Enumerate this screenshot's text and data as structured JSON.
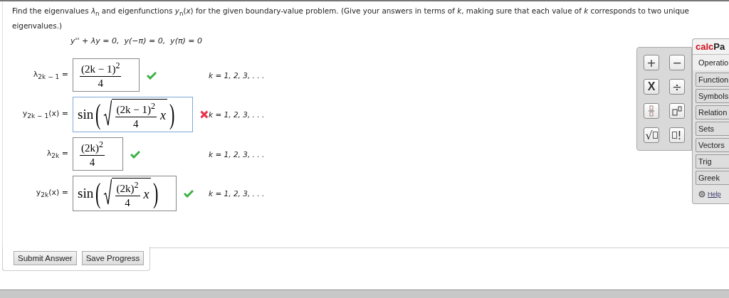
{
  "question": {
    "prompt": "Find the eigenvalues *λ*$_{n}$ and eigenfunctions *y*$_{n}$(*x*) for the given boundary-value problem. (Give your answers in terms of *k*, making sure that each value of *k* corresponds to two unique eigenvalues.)",
    "equation": "y'' + λy = 0,  y(−π) = 0,  y(π) = 0"
  },
  "answers": [
    {
      "label": "λ$_{2k − 1}$ =",
      "kind": "fraction",
      "numerator": "(2k − 1)",
      "exponent": "2",
      "denominator": "4",
      "correct": true,
      "focused": false,
      "range": "k = 1, 2, 3, . . ."
    },
    {
      "label": "y$_{2k − 1}$(x) =",
      "kind": "sine",
      "function": "sin",
      "open": "(",
      "numerator": "(2k − 1)",
      "exponent": "2",
      "denominator": "4",
      "variable": "x",
      "close": ")",
      "correct": false,
      "focused": true,
      "range": "k = 1, 2, 3, . . ."
    },
    {
      "label": "λ$_{2k}$ =",
      "kind": "fraction",
      "numerator": "(2k)",
      "exponent": "2",
      "denominator": "4",
      "correct": true,
      "focused": false,
      "range": "k = 1, 2, 3, . . ."
    },
    {
      "label": "y$_{2k}$(x) =",
      "kind": "sine",
      "function": "sin",
      "open": "(",
      "numerator": "(2k)",
      "exponent": "2",
      "denominator": "4",
      "variable": "x",
      "close": ")",
      "correct": true,
      "focused": false,
      "range": "k = 1, 2, 3, . . ."
    }
  ],
  "buttons": [
    "Submit Answer",
    "Save Progress"
  ],
  "calcpad": {
    "title_accent": "calc",
    "title_rest": "Pa",
    "keys": [
      {
        "kind": "text",
        "text": "+"
      },
      {
        "kind": "text",
        "text": "−"
      },
      {
        "kind": "text",
        "text": "X"
      },
      {
        "kind": "text",
        "text": "÷"
      },
      {
        "kind": "fraction"
      },
      {
        "kind": "power"
      },
      {
        "kind": "root",
        "text": "√"
      },
      {
        "kind": "factorial",
        "text": "!"
      }
    ],
    "tabs": [
      {
        "label": "Operatio",
        "selected": true
      },
      {
        "label": "Function",
        "selected": false
      },
      {
        "label": "Symbols",
        "selected": false
      },
      {
        "label": "Relation",
        "selected": false
      },
      {
        "label": "Sets",
        "selected": false
      },
      {
        "label": "Vectors",
        "selected": false
      },
      {
        "label": "Trig",
        "selected": false
      },
      {
        "label": "Greek",
        "selected": false
      }
    ],
    "help": "Help"
  }
}
